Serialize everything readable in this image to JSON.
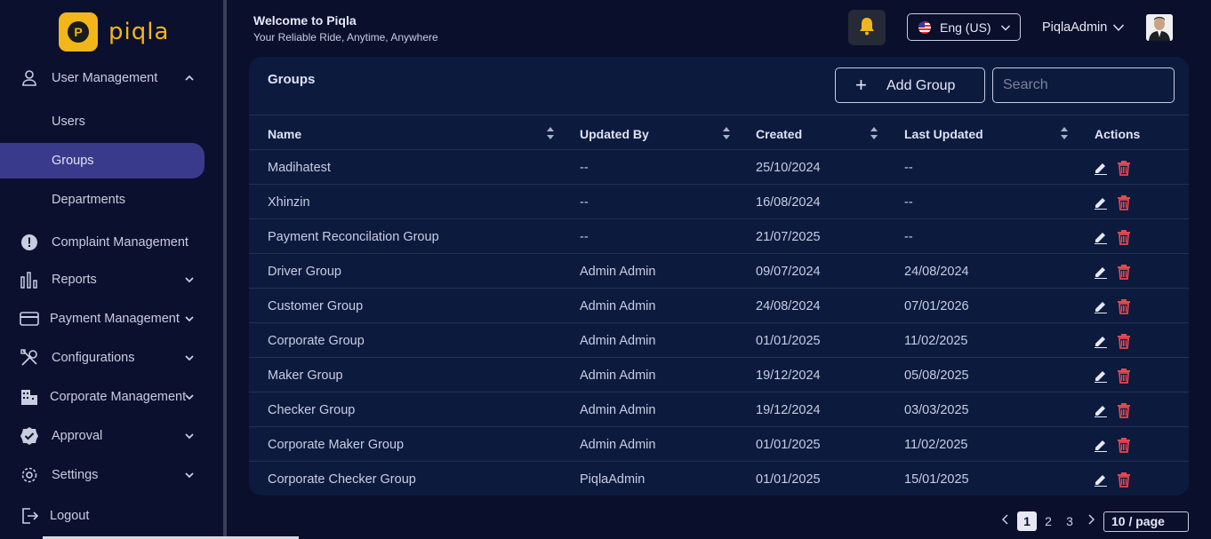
{
  "app": {
    "logo_text": "piqla",
    "logo_mark": "P"
  },
  "header": {
    "welcome_title": "Welcome to Piqla",
    "welcome_subtitle": "Your Reliable Ride, Anytime, Anywhere",
    "language": "Eng (US)",
    "username": "PiqlaAdmin"
  },
  "sidebar": {
    "user_management": "User Management",
    "users": "Users",
    "groups": "Groups",
    "departments": "Departments",
    "complaint_management": "Complaint Management",
    "reports": "Reports",
    "payment_management": "Payment Management",
    "configurations": "Configurations",
    "corporate_management": "Corporate Management",
    "approval": "Approval",
    "settings": "Settings",
    "logout": "Logout"
  },
  "panel": {
    "title": "Groups",
    "add_button": "Add Group",
    "search_placeholder": "Search"
  },
  "table": {
    "headers": {
      "name": "Name",
      "updated_by": "Updated By",
      "created": "Created",
      "last_updated": "Last Updated",
      "actions": "Actions"
    },
    "rows": [
      {
        "name": "Madihatest",
        "updated_by": "--",
        "created": "25/10/2024",
        "last_updated": "--"
      },
      {
        "name": "Xhinzin",
        "updated_by": "--",
        "created": "16/08/2024",
        "last_updated": "--"
      },
      {
        "name": "Payment Reconcilation Group",
        "updated_by": "--",
        "created": "21/07/2025",
        "last_updated": "--"
      },
      {
        "name": "Driver Group",
        "updated_by": "Admin Admin",
        "created": "09/07/2024",
        "last_updated": "24/08/2024"
      },
      {
        "name": "Customer Group",
        "updated_by": "Admin Admin",
        "created": "24/08/2024",
        "last_updated": "07/01/2026"
      },
      {
        "name": "Corporate Group",
        "updated_by": "Admin Admin",
        "created": "01/01/2025",
        "last_updated": "11/02/2025"
      },
      {
        "name": "Maker Group",
        "updated_by": "Admin Admin",
        "created": "19/12/2024",
        "last_updated": "05/08/2025"
      },
      {
        "name": "Checker Group",
        "updated_by": "Admin Admin",
        "created": "19/12/2024",
        "last_updated": "03/03/2025"
      },
      {
        "name": "Corporate Maker Group",
        "updated_by": "Admin Admin",
        "created": "01/01/2025",
        "last_updated": "11/02/2025"
      },
      {
        "name": "Corporate Checker Group",
        "updated_by": "PiqlaAdmin",
        "created": "01/01/2025",
        "last_updated": "15/01/2025"
      }
    ]
  },
  "pagination": {
    "pages": [
      "1",
      "2",
      "3"
    ],
    "current": "1",
    "page_size": "10 / page"
  },
  "colors": {
    "accent": "#f2b619",
    "active_nav": "#3a3a8c",
    "delete": "#e5484d",
    "panel": "#0c1a3e"
  }
}
